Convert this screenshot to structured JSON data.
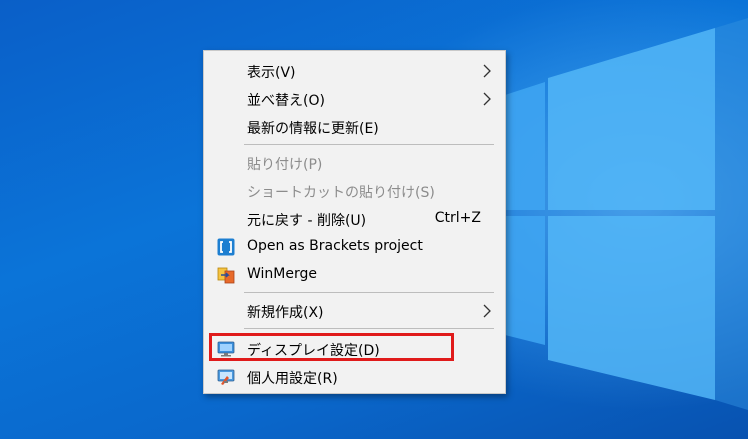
{
  "context_menu": {
    "items": [
      {
        "label": "表示(V)",
        "submenu": true
      },
      {
        "label": "並べ替え(O)",
        "submenu": true
      },
      {
        "label": "最新の情報に更新(E)"
      },
      {
        "label": "貼り付け(P)",
        "disabled": true
      },
      {
        "label": "ショートカットの貼り付け(S)",
        "disabled": true
      },
      {
        "label": "元に戻す - 削除(U)",
        "shortcut": "Ctrl+Z"
      },
      {
        "label": "Open as Brackets project",
        "icon": "brackets-icon"
      },
      {
        "label": "WinMerge",
        "icon": "winmerge-icon"
      },
      {
        "label": "新規作成(X)",
        "submenu": true
      },
      {
        "label": "ディスプレイ設定(D)",
        "icon": "display-settings-icon",
        "highlighted": true
      },
      {
        "label": "個人用設定(R)",
        "icon": "personalize-icon"
      }
    ]
  },
  "colors": {
    "desktop": "#0b74d8",
    "menu_bg": "#f2f2f2",
    "highlight_box": "#e01b1b",
    "disabled_text": "#8c8c8c"
  }
}
